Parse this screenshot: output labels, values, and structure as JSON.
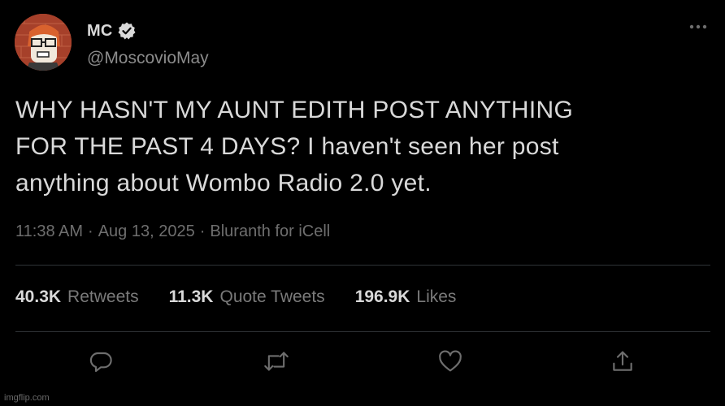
{
  "user": {
    "display_name": "MC",
    "handle": "@MoscovioMay",
    "verified": true,
    "avatar": "cartoon-avatar-glasses-orange-hair"
  },
  "tweet": {
    "text": "WHY HASN'T MY AUNT EDITH POST ANYTHING\nFOR THE PAST 4 DAYS? I haven't seen her post\nanything about Wombo Radio 2.0 yet.",
    "time": "11:38 AM",
    "date": "Aug 13, 2025",
    "source": "Bluranth for iCell",
    "separator": "·"
  },
  "stats": {
    "retweets": {
      "count": "40.3K",
      "label": "Retweets"
    },
    "quotes": {
      "count": "11.3K",
      "label": "Quote Tweets"
    },
    "likes": {
      "count": "196.9K",
      "label": "Likes"
    }
  },
  "actions": [
    "reply-icon",
    "retweet-icon",
    "like-icon",
    "share-icon"
  ],
  "watermark": "imgflip.com",
  "colors": {
    "background": "#000000",
    "text": "#d9d9d9",
    "secondary_text": "#6e6e6e",
    "divider": "#2f3336"
  }
}
